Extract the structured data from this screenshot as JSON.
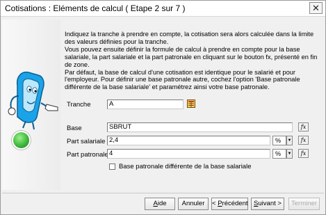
{
  "window": {
    "title": "Cotisations : Eléments de calcul ( Etape 2 sur 7 )",
    "close_glyph": "✕"
  },
  "instructions": [
    "Indiquez la tranche à prendre en compte, la cotisation sera alors calculée dans la limite des valeurs définies pour la tranche.",
    "Vous pouvez ensuite définir la formule de calcul à prendre en compte pour la base salariale, la part salariale et la part patronale en cliquant sur le bouton fx, présenté en fin de zone.",
    "Par défaut, la base de calcul d'une cotisation est identique pour le salarié et pour l'employeur. Pour définir une base patronale autre, cochez l'option 'Base patronale différente de la base salariale' et paramétrez ainsi votre base patronale."
  ],
  "form": {
    "tranche": {
      "label": "Tranche",
      "value": "A"
    },
    "base": {
      "label": "Base",
      "value": "SBRUT"
    },
    "part_salariale": {
      "label": "Part salariale",
      "value": "2,4",
      "unit": "%"
    },
    "part_patronale": {
      "label": "Part patronale",
      "value": "4",
      "unit": "%"
    },
    "fx_label": "fx",
    "checkbox": {
      "label": "Base patronale différente de la base salariale",
      "checked": false
    }
  },
  "buttons": {
    "aide": {
      "label": "Aide",
      "underline": "A",
      "rest": "ide"
    },
    "annuler": {
      "label": "Annuler"
    },
    "precedent": {
      "label": "< Précédent",
      "pre": "< ",
      "underline": "P",
      "rest": "récédent"
    },
    "suivant": {
      "label": "Suivant >",
      "underline": "S",
      "rest": "uivant >"
    },
    "terminer": {
      "label": "Terminer",
      "enabled": false
    }
  },
  "icons": {
    "assistant": "assistant-mascot-icon",
    "status_light": "green-status-light-icon",
    "picker": "table-picker-icon",
    "dropdown_arrow": "▼"
  },
  "colors": {
    "accent_green": "#3db83d",
    "mascot_blue": "#1aa3e8"
  }
}
